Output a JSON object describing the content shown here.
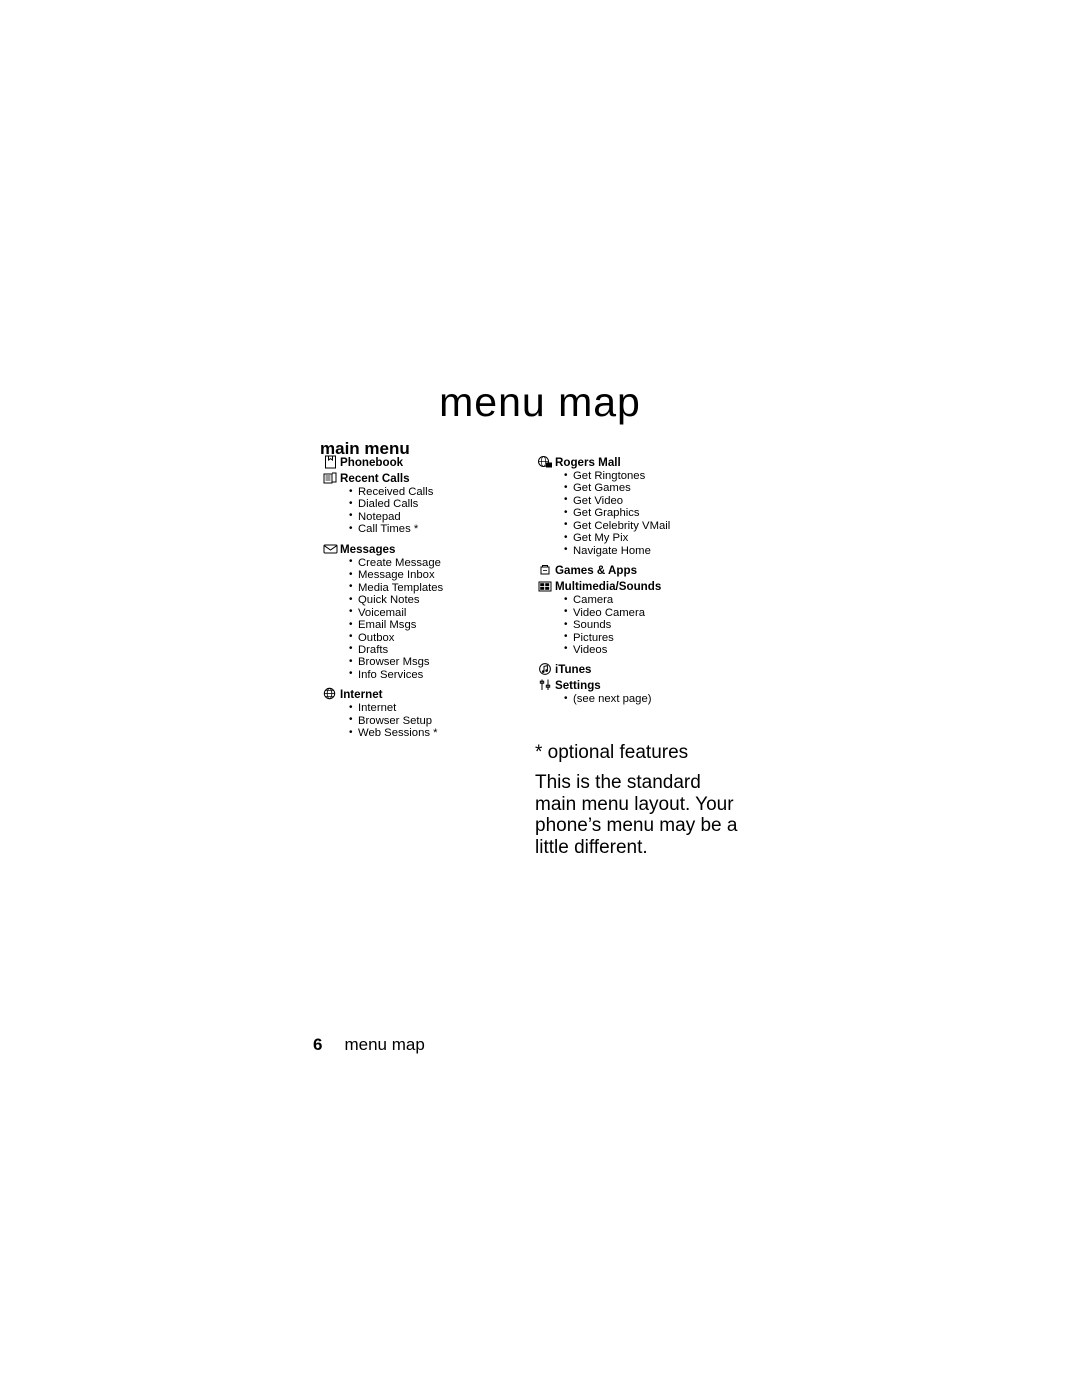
{
  "page": {
    "title": "menu map",
    "section_heading": "main menu",
    "footer_page_number": "6",
    "footer_label": "menu map"
  },
  "notes": {
    "optional": "* optional features",
    "body": "This is the standard main menu layout. Your phone’s menu may be a little different."
  },
  "left_column": [
    {
      "icon": "phonebook-icon",
      "label": "Phonebook",
      "items": []
    },
    {
      "icon": "recent-calls-icon",
      "label": "Recent Calls",
      "items": [
        "Received Calls",
        "Dialed Calls",
        "Notepad",
        "Call Times *"
      ]
    },
    {
      "icon": "messages-envelope-icon",
      "label": "Messages",
      "items": [
        "Create Message",
        "Message Inbox",
        "Media Templates",
        "Quick Notes",
        "Voicemail",
        "Email Msgs",
        "Outbox",
        "Drafts",
        "Browser Msgs",
        "Info Services"
      ]
    },
    {
      "icon": "internet-globe-icon",
      "label": "Internet",
      "items": [
        "Internet",
        "Browser Setup",
        "Web Sessions *"
      ]
    }
  ],
  "right_column": [
    {
      "icon": "rogers-mall-icon",
      "label": "Rogers Mall",
      "items": [
        "Get Ringtones",
        "Get Games",
        "Get Video",
        "Get Graphics",
        "Get Celebrity VMail",
        "Get My Pix",
        "Navigate Home"
      ]
    },
    {
      "icon": "games-apps-icon",
      "label": "Games & Apps",
      "items": []
    },
    {
      "icon": "multimedia-sounds-icon",
      "label": "Multimedia/Sounds",
      "items": [
        "Camera",
        "Video Camera",
        "Sounds",
        "Pictures",
        "Videos"
      ]
    },
    {
      "icon": "itunes-icon",
      "label": "iTunes",
      "items": []
    },
    {
      "icon": "settings-icon",
      "label": "Settings",
      "items": [
        "(see next page)"
      ]
    }
  ]
}
